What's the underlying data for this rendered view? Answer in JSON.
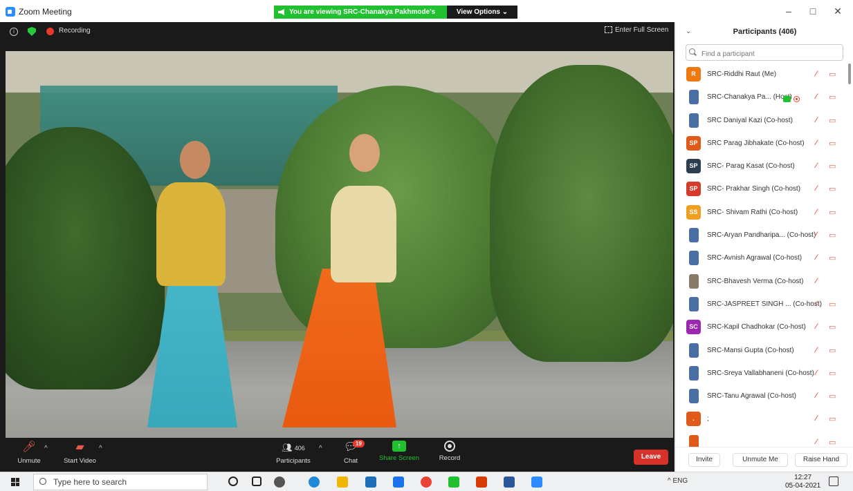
{
  "window": {
    "title": "Zoom Meeting",
    "share_banner": "You are viewing SRC-Chanakya Pakhmode's screen",
    "view_options": "View Options ⌄",
    "minimize": "–",
    "maximize": "□",
    "close": "✕"
  },
  "meeting": {
    "recording_label": "Recording",
    "fullscreen_label": "Enter Full Screen"
  },
  "toolbar": {
    "unmute": "Unmute",
    "start_video": "Start Video",
    "participants_label": "Participants",
    "participants_count": "406",
    "chat": "Chat",
    "chat_badge": "19",
    "share_screen": "Share Screen",
    "record": "Record",
    "leave": "Leave"
  },
  "panel": {
    "title": "Participants (406)",
    "search_placeholder": "Find a participant",
    "participants": [
      {
        "avatar": "R",
        "color": "#f0790f",
        "name": "SRC-Riddhi Raut (Me)"
      },
      {
        "avatar": "",
        "color": "#4a6fa5",
        "name": "SRC-Chanakya Pa... (Host)"
      },
      {
        "avatar": "",
        "color": "#4a6fa5",
        "name": "SRC Daniyal Kazi (Co-host)"
      },
      {
        "avatar": "SP",
        "color": "#e05a1a",
        "name": "SRC Parag Jibhakate (Co-host)"
      },
      {
        "avatar": "SP",
        "color": "#2d3e50",
        "name": "SRC- Parag Kasat (Co-host)"
      },
      {
        "avatar": "SP",
        "color": "#d63a2a",
        "name": "SRC- Prakhar Singh (Co-host)"
      },
      {
        "avatar": "SS",
        "color": "#f0a020",
        "name": "SRC- Shivam Rathi (Co-host)"
      },
      {
        "avatar": "",
        "color": "#4a6fa5",
        "name": "SRC-Aryan Pandharipa... (Co-host)"
      },
      {
        "avatar": "",
        "color": "#4a6fa5",
        "name": "SRC-Avnish Agrawal (Co-host)"
      },
      {
        "avatar": "",
        "color": "#8a7a6a",
        "name": "SRC-Bhavesh Verma (Co-host)"
      },
      {
        "avatar": "",
        "color": "#4a6fa5",
        "name": "SRC-JASPREET SINGH ... (Co-host)"
      },
      {
        "avatar": "SC",
        "color": "#9c27b0",
        "name": "SRC-Kapil Chadhokar (Co-host)"
      },
      {
        "avatar": "",
        "color": "#4a6fa5",
        "name": "SRC-Mansi Gupta (Co-host)"
      },
      {
        "avatar": "",
        "color": "#4a6fa5",
        "name": "SRC-Sreya Vallabhaneni (Co-host)"
      },
      {
        "avatar": "",
        "color": "#4a6fa5",
        "name": "SRC-Tanu Agrawal (Co-host)"
      },
      {
        "avatar": ".",
        "color": "#e05a1a",
        "name": ";"
      },
      {
        "avatar": "",
        "color": "#e05a1a",
        "name": ""
      }
    ],
    "invite": "Invite",
    "unmute_me": "Unmute Me",
    "raise_hand": "Raise Hand"
  },
  "taskbar": {
    "search_placeholder": "Type here to search",
    "tray_text": "^  ENG",
    "time": "12:27",
    "date": "05-04-2021"
  }
}
